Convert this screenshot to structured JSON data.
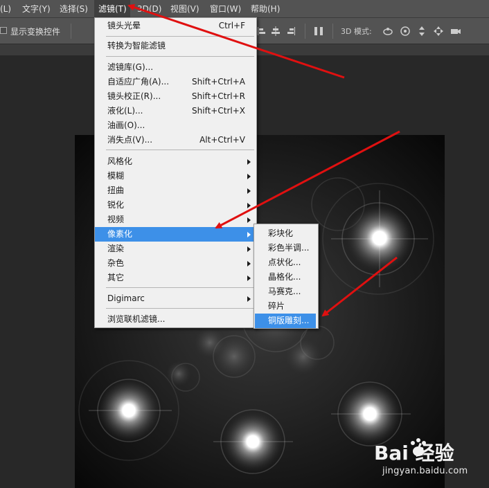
{
  "menubar": {
    "items": [
      {
        "label": "(L)"
      },
      {
        "label": "文字(Y)"
      },
      {
        "label": "选择(S)"
      },
      {
        "label": "滤镜(T)"
      },
      {
        "label": "3D(D)"
      },
      {
        "label": "视图(V)"
      },
      {
        "label": "窗口(W)"
      },
      {
        "label": "帮助(H)"
      }
    ]
  },
  "options_bar": {
    "transform_label": "显示变换控件",
    "mode_3d_label": "3D 模式:"
  },
  "filter_menu": {
    "items": [
      {
        "label": "镜头光晕",
        "shortcut": "Ctrl+F"
      },
      {
        "label": "转换为智能滤镜"
      },
      {
        "label": "滤镜库(G)..."
      },
      {
        "label": "自适应广角(A)...",
        "shortcut": "Shift+Ctrl+A"
      },
      {
        "label": "镜头校正(R)...",
        "shortcut": "Shift+Ctrl+R"
      },
      {
        "label": "液化(L)...",
        "shortcut": "Shift+Ctrl+X"
      },
      {
        "label": "油画(O)..."
      },
      {
        "label": "消失点(V)...",
        "shortcut": "Alt+Ctrl+V"
      },
      {
        "label": "风格化"
      },
      {
        "label": "模糊"
      },
      {
        "label": "扭曲"
      },
      {
        "label": "锐化"
      },
      {
        "label": "视频"
      },
      {
        "label": "像素化"
      },
      {
        "label": "渲染"
      },
      {
        "label": "杂色"
      },
      {
        "label": "其它"
      },
      {
        "label": "Digimarc"
      },
      {
        "label": "浏览联机滤镜..."
      }
    ]
  },
  "pixelate_submenu": {
    "items": [
      {
        "label": "彩块化"
      },
      {
        "label": "彩色半调..."
      },
      {
        "label": "点状化..."
      },
      {
        "label": "晶格化..."
      },
      {
        "label": "马赛克..."
      },
      {
        "label": "碎片"
      },
      {
        "label": "铜版雕刻..."
      }
    ]
  },
  "watermark": {
    "logo_text": "Bai 经验",
    "url": "jingyan.baidu.com"
  },
  "colors": {
    "highlight": "#3d90e8",
    "arrow": "#e01010",
    "menu_bg": "#f0f0f0",
    "chrome": "#535353"
  }
}
